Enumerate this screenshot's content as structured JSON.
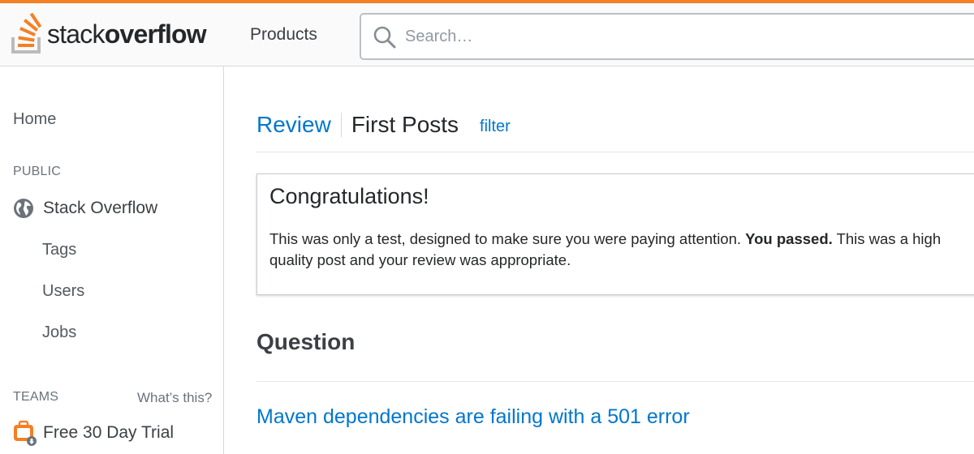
{
  "brand": {
    "name_light": "stack",
    "name_bold": "overflow",
    "accent_color": "#f48024",
    "icon": "stack-overflow-logo"
  },
  "header": {
    "products_label": "Products",
    "search_placeholder": "Search…",
    "search_icon": "search-icon"
  },
  "sidebar": {
    "home_label": "Home",
    "public_heading": "PUBLIC",
    "stackoverflow_label": "Stack Overflow",
    "stackoverflow_icon": "globe-icon",
    "items": [
      {
        "label": "Tags"
      },
      {
        "label": "Users"
      },
      {
        "label": "Jobs"
      }
    ],
    "teams_heading": "TEAMS",
    "teams_help_link": "What’s this?",
    "trial_label": "Free 30 Day Trial",
    "trial_icon": "briefcase-icon"
  },
  "main": {
    "breadcrumb_review": "Review",
    "breadcrumb_queue": "First Posts",
    "filter_label": "filter",
    "notice": {
      "title": "Congratulations!",
      "text_before": "This was only a test, designed to make sure you were paying attention. ",
      "text_bold": "You passed.",
      "text_after": " This was a high quality post and your review was appropriate."
    },
    "question_heading": "Question",
    "question_title": "Maven dependencies are failing with a 501 error"
  },
  "colors": {
    "link": "#0077cc",
    "accent": "#f48024",
    "text": "#242729",
    "muted": "#6a737c",
    "border": "#d6d9dc"
  }
}
